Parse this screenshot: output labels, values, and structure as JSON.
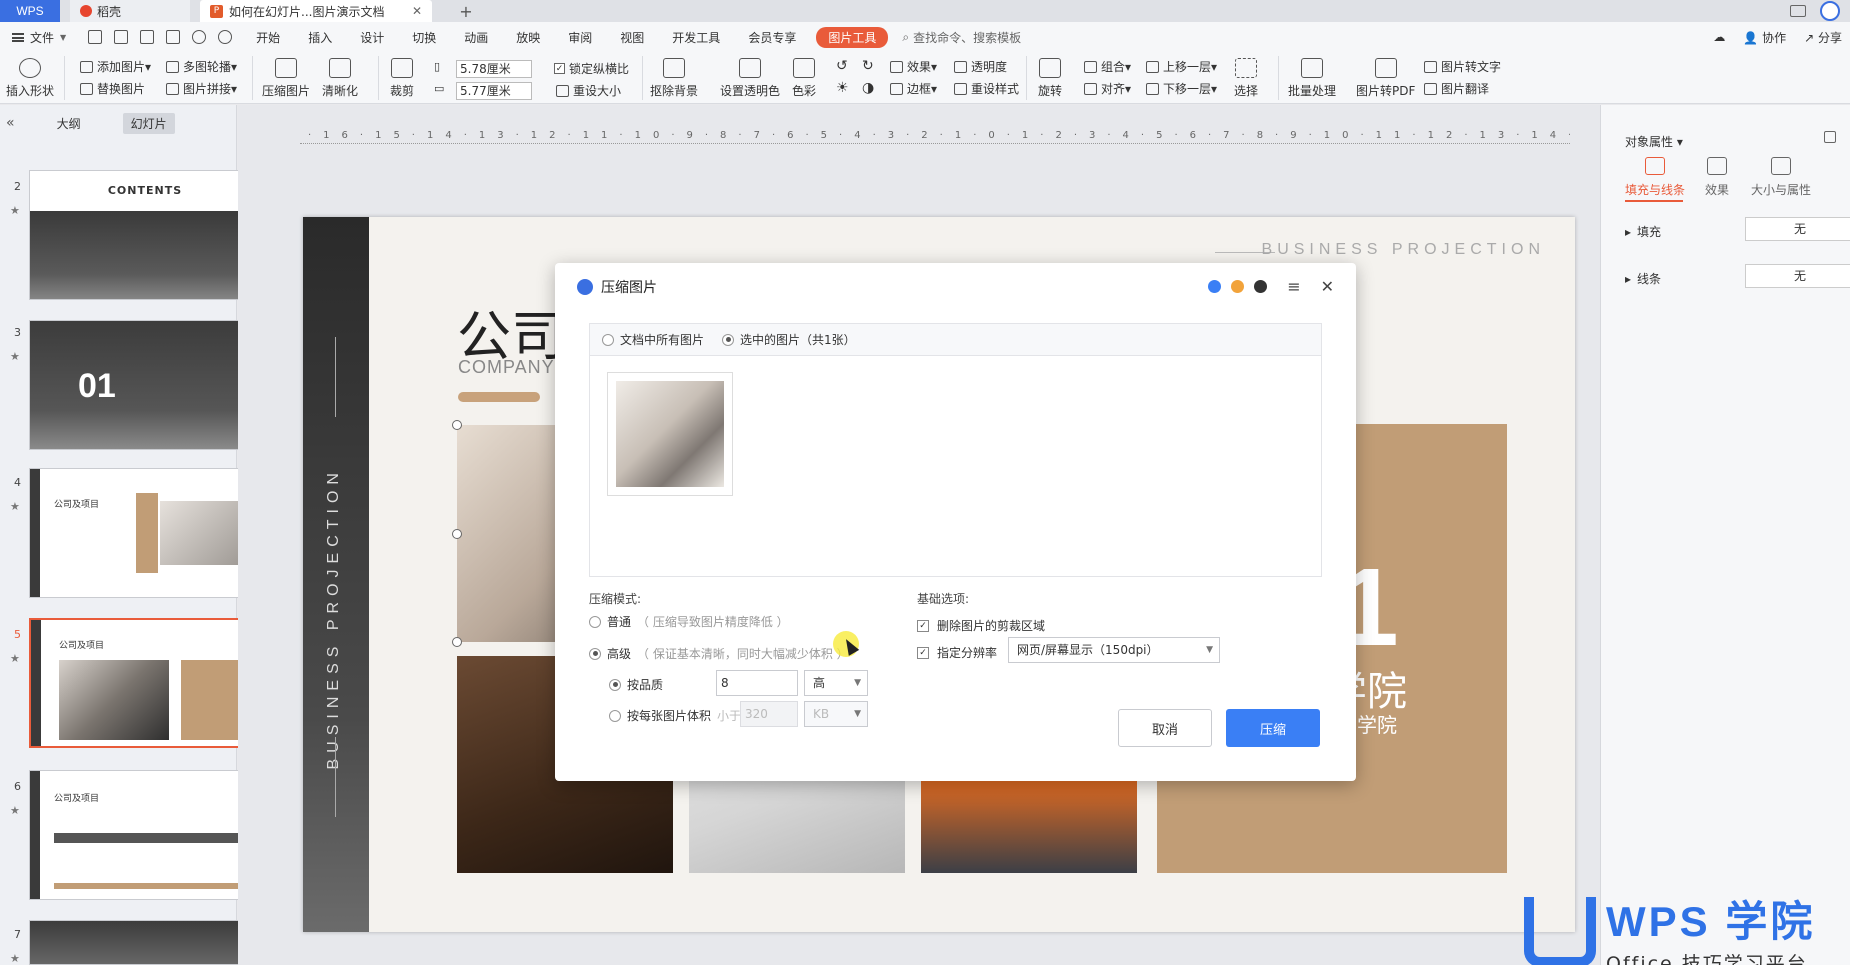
{
  "titlebar": {
    "tabs": [
      "WPS",
      "稻壳",
      "如何在幻灯片...图片演示文档"
    ],
    "new_tab": "+"
  },
  "menubar": {
    "file": "文件",
    "items": [
      "开始",
      "插入",
      "设计",
      "切换",
      "动画",
      "放映",
      "审阅",
      "视图",
      "开发工具",
      "会员专享"
    ],
    "active": "图片工具",
    "search": "查找命令、搜索模板",
    "right": [
      "协作",
      "分享"
    ]
  },
  "ribbon": {
    "insert_shape": "插入形状",
    "add_image": "添加图片",
    "multi_carousel": "多图轮播",
    "replace_image": "替换图片",
    "image_collage": "图片拼接",
    "compress_image": "压缩图片",
    "sharpen": "清晰化",
    "crop": "裁剪",
    "width": "5.78厘米",
    "height": "5.77厘米",
    "lock_ratio": "锁定纵横比",
    "reset_size": "重设大小",
    "remove_bg": "抠除背景",
    "set_transparent": "设置透明色",
    "color": "色彩",
    "effect": "效果",
    "transparency": "透明度",
    "border": "边框",
    "reset_style": "重设样式",
    "rotate": "旋转",
    "group": "组合",
    "align": "对齐",
    "move_up": "上移一层",
    "move_down": "下移一层",
    "select": "选择",
    "batch": "批量处理",
    "to_pdf": "图片转PDF",
    "to_text": "图片转文字",
    "translate": "图片翻译"
  },
  "leftpane": {
    "tabs": [
      "大纲",
      "幻灯片"
    ],
    "slides": [
      {
        "num": "2",
        "title": "CONTENTS"
      },
      {
        "num": "3",
        "title": "01"
      },
      {
        "num": "4",
        "title": "公司及项目"
      },
      {
        "num": "5",
        "title": "公司及项目"
      },
      {
        "num": "6",
        "title": "公司及项目"
      },
      {
        "num": "7",
        "title": ""
      }
    ]
  },
  "ruler": "·16·15·14·13·12·11·10·9·8·7·6·5·4·3·2·1·0·1·2·3·4·5·6·7·8·9·10·11·12·13·14·15·16·",
  "slide": {
    "band_text": "BUSINESS PROJECTION",
    "top_right": "BUSINESS PROJECTION",
    "title": "公司",
    "subtitle": "COMPANY &",
    "no_text": ".1",
    "wps_text": "学院",
    "wps_text2": "学院"
  },
  "rightpane": {
    "title": "对象属性",
    "tabs": [
      "填充与线条",
      "效果",
      "大小与属性"
    ],
    "rows": [
      {
        "label": "填充",
        "value": "无"
      },
      {
        "label": "线条",
        "value": "无"
      }
    ]
  },
  "dialog": {
    "title": "压缩图片",
    "scope_all": "文档中所有图片",
    "scope_selected": "选中的图片（共1张）",
    "mode_label": "压缩模式:",
    "normal": "普通",
    "normal_hint": "（ 压缩导致图片精度降低 ）",
    "advanced": "高级",
    "advanced_hint": "（ 保证基本清晰，同时大幅减少体积 ）",
    "by_quality": "按品质",
    "quality_value": "8",
    "quality_level": "高",
    "by_size": "按每张图片体积",
    "less_than": "小于",
    "size_value": "320",
    "size_unit": "KB",
    "basic_label": "基础选项:",
    "delete_crop": "删除图片的剪裁区域",
    "resolution_label": "指定分辨率",
    "resolution_value": "网页/屏幕显示（150dpi）",
    "cancel": "取消",
    "confirm": "压缩"
  },
  "watermark": {
    "title": "WPS 学院",
    "subtitle": "Office 技巧学习平台"
  },
  "colors": {
    "accent": "#e95b3a",
    "primary": "#3a7ff5",
    "gold": "#c19d76"
  }
}
